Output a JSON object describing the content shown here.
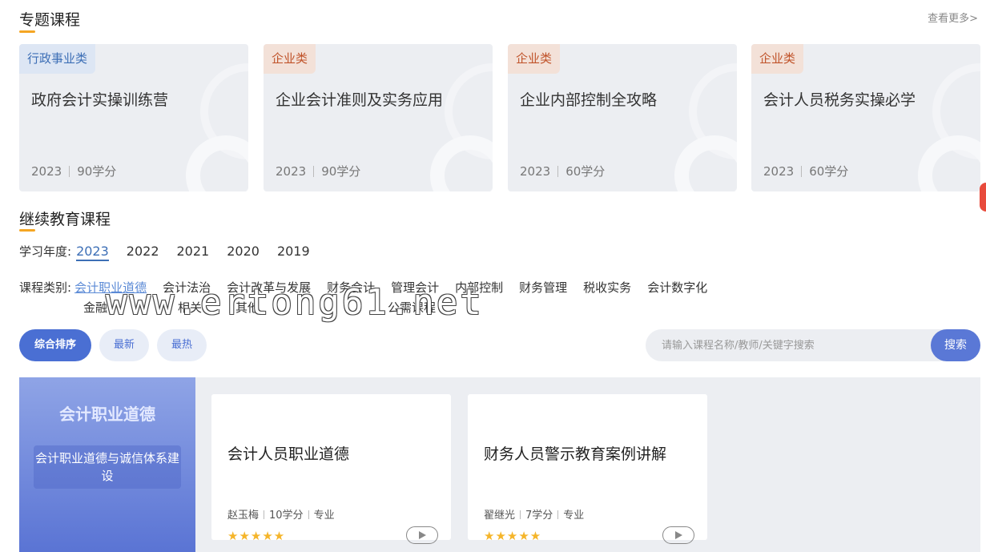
{
  "topics": {
    "title": "专题课程",
    "more": "查看更多>",
    "cards": [
      {
        "tag": "行政事业类",
        "name": "政府会计实操训练营",
        "year": "2023",
        "credits": "90学分",
        "tag_style": "blue"
      },
      {
        "tag": "企业类",
        "name": "企业会计准则及实务应用",
        "year": "2023",
        "credits": "90学分",
        "tag_style": "orange"
      },
      {
        "tag": "企业类",
        "name": "企业内部控制全攻略",
        "year": "2023",
        "credits": "60学分",
        "tag_style": "orange"
      },
      {
        "tag": "企业类",
        "name": "会计人员税务实操必学",
        "year": "2023",
        "credits": "60学分",
        "tag_style": "orange"
      }
    ]
  },
  "continuing": {
    "title": "继续教育课程",
    "year_label": "学习年度:",
    "years": [
      "2023",
      "2022",
      "2021",
      "2020",
      "2019"
    ],
    "category_label": "课程类别:",
    "categories": [
      "会计职业道德",
      "会计法治",
      "会计改革与发展",
      "财务会计",
      "管理会计",
      "内部控制",
      "财务管理",
      "税收实务",
      "会计数字化"
    ],
    "categories_row2": [
      "金融",
      "相关",
      "其他",
      "公需课程"
    ]
  },
  "watermark": "www.ertong61.net",
  "sort": {
    "comprehensive": "综合排序",
    "latest": "最新",
    "hottest": "最热"
  },
  "search": {
    "placeholder": "请输入课程名称/教师/关键字搜索",
    "button": "搜索"
  },
  "feature": {
    "title": "会计职业道德",
    "subtitle": "会计职业道德与诚信体系建设"
  },
  "courses": [
    {
      "name": "会计人员职业道德",
      "teacher": "赵玉梅",
      "credits": "10学分",
      "type": "专业",
      "stars": "★★★★★"
    },
    {
      "name": "财务人员警示教育案例讲解",
      "teacher": "翟继光",
      "credits": "7学分",
      "type": "专业",
      "stars": "★★★★★"
    }
  ]
}
